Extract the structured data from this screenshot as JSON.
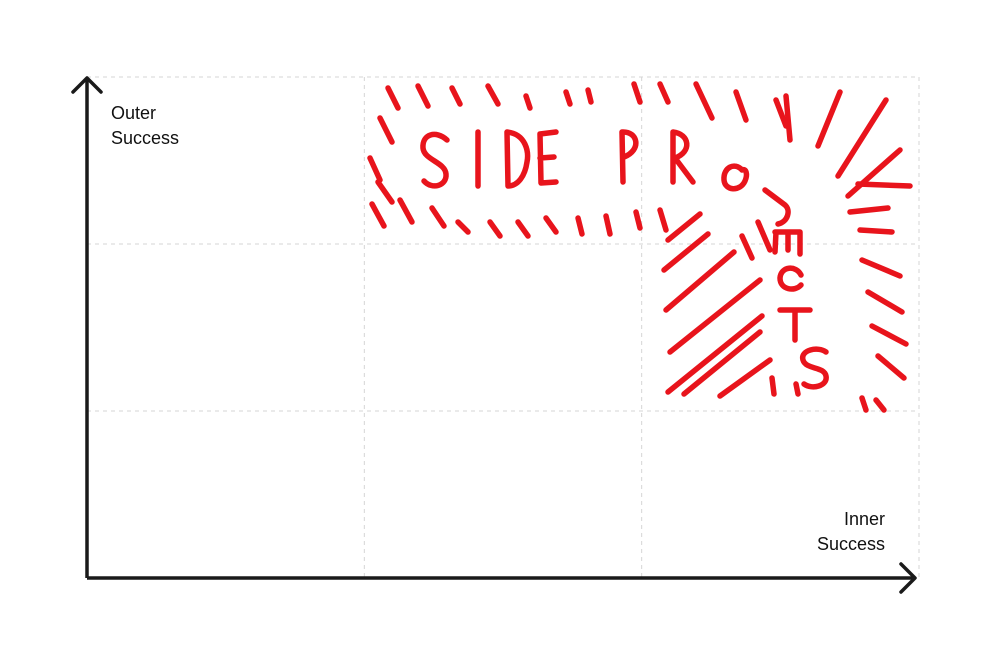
{
  "axes": {
    "y_label": "Outer\nSuccess",
    "x_label": "Inner\nSuccess"
  },
  "grid": {
    "columns": 3,
    "rows": 3
  },
  "highlight": {
    "text": "SIDE PROJECTS",
    "region": "top-row and right-column cells",
    "color": "#e8141c"
  },
  "colors": {
    "axis": "#1a1a1a",
    "gridline": "#d6d6d6",
    "annotation": "#e8141c"
  }
}
